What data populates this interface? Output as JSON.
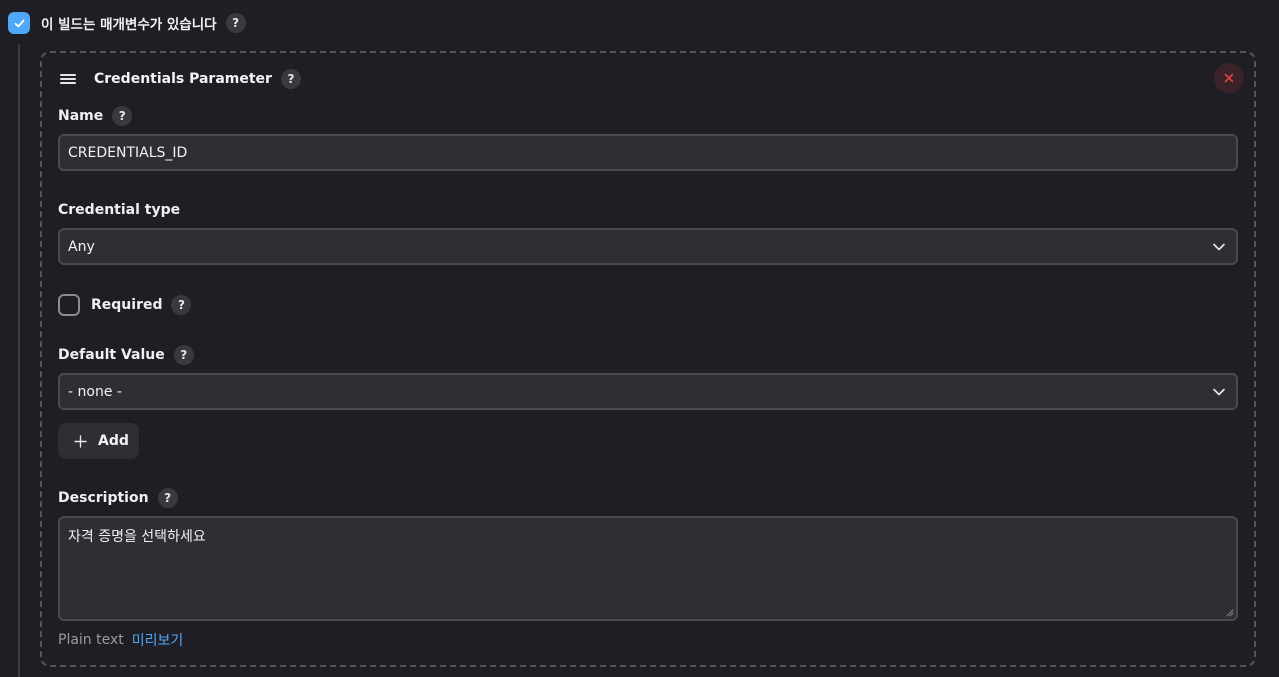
{
  "top": {
    "checkbox_checked": true,
    "label": "이 빌드는 매개변수가 있습니다",
    "help": "?"
  },
  "card": {
    "title": "Credentials Parameter",
    "help": "?",
    "name": {
      "label": "Name",
      "help": "?",
      "value": "CREDENTIALS_ID"
    },
    "credential_type": {
      "label": "Credential type",
      "value": "Any"
    },
    "required": {
      "label": "Required",
      "help": "?",
      "checked": false
    },
    "default_value": {
      "label": "Default Value",
      "help": "?",
      "value": "- none -"
    },
    "add_button": "Add",
    "description": {
      "label": "Description",
      "help": "?",
      "value": "자격 증명을 선택하세요"
    },
    "plain_text": "Plain text",
    "preview": "미리보기"
  },
  "colors": {
    "accent": "#4fa7f7",
    "background": "#1f1e25",
    "close": "#e0403f"
  },
  "icons": [
    "check-icon",
    "help-icon",
    "drag-handle-icon",
    "close-icon",
    "chevron-down-icon",
    "plus-icon",
    "resize-handle-icon"
  ]
}
